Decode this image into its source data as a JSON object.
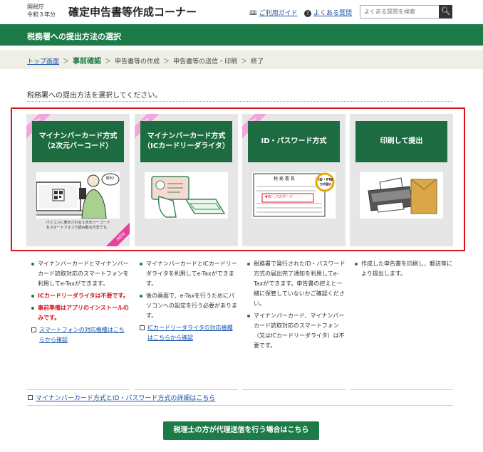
{
  "header": {
    "agency": "国税庁",
    "year": "令和３年分",
    "title": "確定申告書等作成コーナー",
    "guide_link": "ご利用ガイド",
    "faq_link": "よくある質問",
    "search_placeholder": "よくある質問を検索",
    "icons": [
      "book-icon",
      "question-icon",
      "search-icon"
    ]
  },
  "banner": {
    "title": "税務署への提出方法の選択"
  },
  "breadcrumb": {
    "items": [
      "トップ画面",
      "事前確認",
      "申告書等の作成",
      "申告書等の送信・印刷",
      "終了"
    ],
    "separator": "＞",
    "current_index": 1
  },
  "instruction": "税務署への提出方法を選択してください。",
  "methods": [
    {
      "ribbon": "e-Tax",
      "heading": "マイナンバーカード方式\n（2次元バーコード）",
      "caption": "パソコンに表示される２次元バーコード\nをスマートフォンで読み取る方式です。",
      "badge": "NEW",
      "bubble": "便利！",
      "bullets": [
        {
          "text": "マイナンバーカードとマイナンバーカード読取対応のスマートフォンを利用してe-Taxができます。",
          "style": "normal"
        },
        {
          "text": "ICカードリーダライタは不要です。",
          "style": "red"
        },
        {
          "text": "事前準備はアプリのインストールのみです。",
          "style": "red"
        }
      ],
      "link": "スマートフォンの対応機種はこちらから確認"
    },
    {
      "ribbon": "e-Tax",
      "heading": "マイナンバーカード方式\n（ICカードリーダライタ）",
      "bullets": [
        {
          "text": "マイナンバーカードとICカードリーダライタを利用してe-Taxができます。",
          "style": "normal"
        },
        {
          "text": "後の画面で、e-Taxを行うためにパソコンへの設定を行う必要があります。",
          "style": "normal"
        }
      ],
      "link": "ICカードリーダライタの対応機種はこちらから確認"
    },
    {
      "ribbon": "e-Tax",
      "heading": "ID・パスワード方式",
      "doc_title": "税 務 署 長",
      "stamp": "ID・PW",
      "stamp_sub": "方式届出",
      "pw_label": "▼ID・パスワード",
      "bullets": [
        {
          "text": "税務署で発行されたID・パスワード方式の届出完了通知を利用してe-Taxができます。申告書の控えと一緒に保管していないかご確認ください。",
          "style": "normal"
        },
        {
          "text": "マイナンバーカード、マイナンバーカード読取対応のスマートフォン（又はICカードリーダライタ）は不要です。",
          "style": "normal"
        }
      ],
      "link": ""
    },
    {
      "ribbon": "",
      "heading": "印刷して提出",
      "bullets": [
        {
          "text": "作成した申告書を印刷し、郵送等により提出します。",
          "style": "normal"
        }
      ],
      "link": ""
    }
  ],
  "detail_link": "マイナンバーカード方式とID・パスワード方式の詳細はこちら",
  "tax_accountant_button": "税理士の方が代理送信を行う場合はこちら",
  "colors": {
    "brand_green": "#1d7b47",
    "card_green": "#1d6b40",
    "highlight_red": "#d7141e",
    "link_blue": "#1a55a8",
    "ribbon_pink": "#f2a6dd"
  }
}
